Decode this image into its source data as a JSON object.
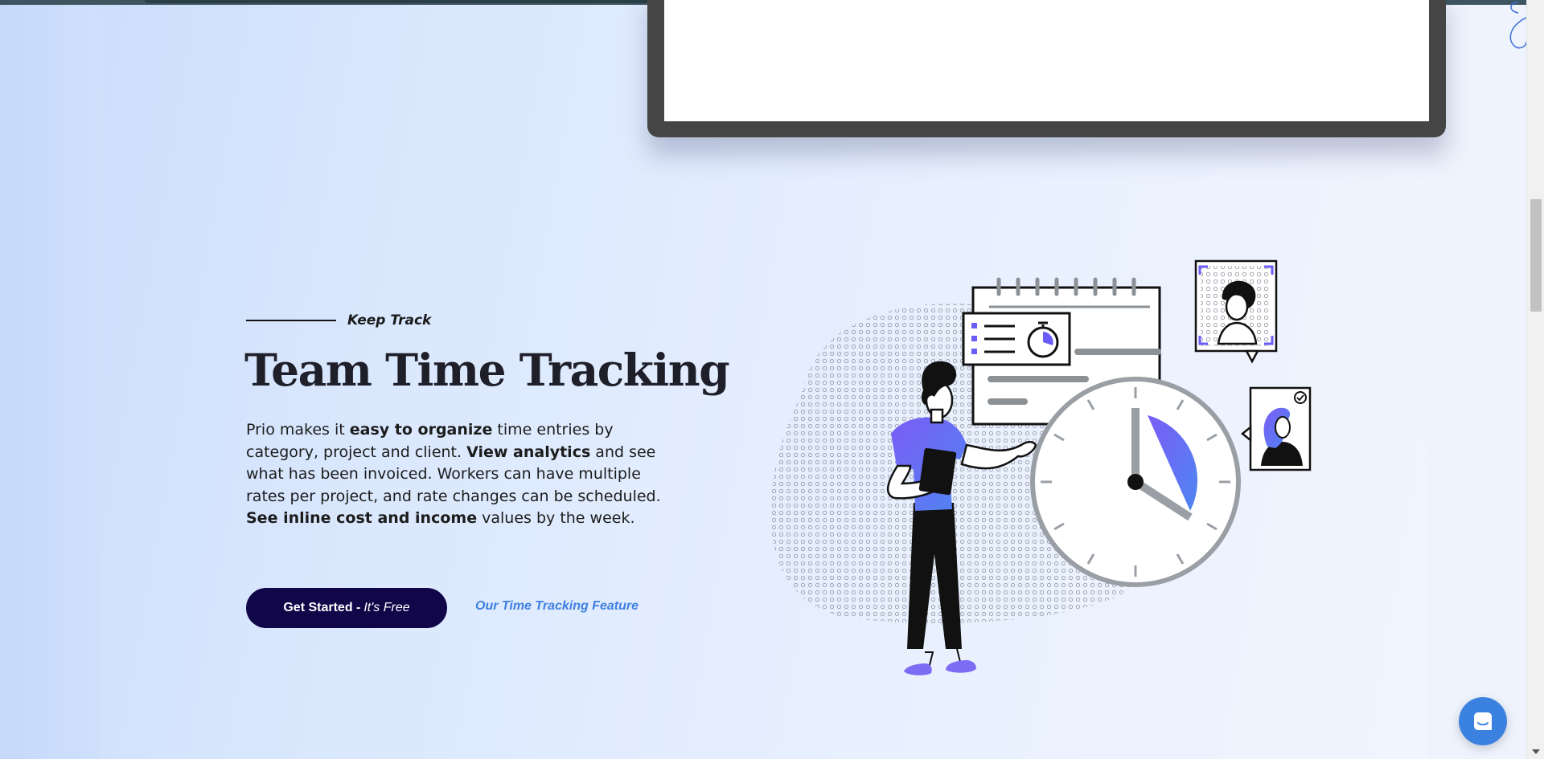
{
  "section": {
    "eyebrow": "Keep Track",
    "title": "Team Time Tracking",
    "body": {
      "p1": "Prio makes it ",
      "b1": "easy to organize",
      "p2": " time entries by category, project and client. ",
      "b2": "View analytics",
      "p3": " and see what has been invoiced. Workers can have multiple rates per project, and rate changes can be scheduled. ",
      "b3": "See inline cost and income",
      "p4": " values by the week."
    },
    "cta": {
      "label": "Get Started - ",
      "sub_label": "It's Free"
    },
    "feature_link": "Our Time Tracking Feature"
  },
  "illustration": {
    "icon": "time-tracking-illustration",
    "accent_colors": [
      "#6a5cf6",
      "#4f7df2"
    ]
  },
  "chat": {
    "icon": "chat-icon",
    "color": "#3b82e0"
  },
  "colors": {
    "cta_bg": "#100648",
    "link": "#3e7fe0",
    "headline": "#1f1f2a"
  }
}
